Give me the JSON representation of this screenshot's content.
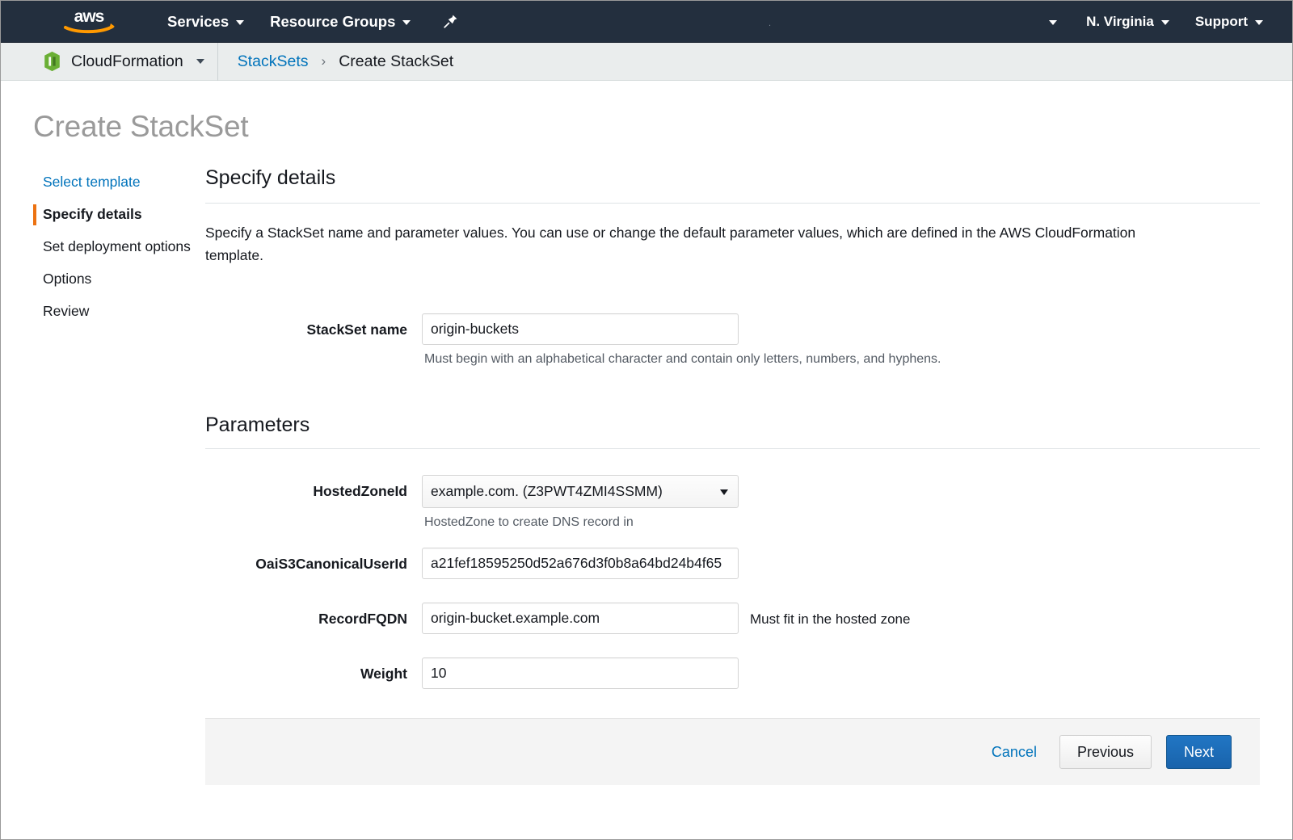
{
  "topnav": {
    "logo_alt": "aws-logo",
    "services_label": "Services",
    "resource_groups_label": "Resource Groups",
    "pin_icon": "pin-icon",
    "account_placeholder": ".",
    "region_label": "N. Virginia",
    "support_label": "Support",
    "bg_color": "#232f3e"
  },
  "breadcrumb": {
    "service_icon": "cloudformation-icon",
    "service_label": "CloudFormation",
    "items": [
      {
        "label": "StackSets",
        "link": true
      },
      {
        "label": "Create StackSet",
        "link": false
      }
    ],
    "separator": "›",
    "link_color": "#0073bb"
  },
  "page": {
    "title": "Create StackSet"
  },
  "sidebar": {
    "items": [
      {
        "label": "Select template",
        "state": "link"
      },
      {
        "label": "Specify details",
        "state": "active"
      },
      {
        "label": "Set deployment options",
        "state": "default"
      },
      {
        "label": "Options",
        "state": "default"
      },
      {
        "label": "Review",
        "state": "default"
      }
    ],
    "active_marker_color": "#ec7211"
  },
  "main": {
    "heading": "Specify details",
    "description": "Specify a StackSet name and parameter values. You can use or change the default parameter values, which are defined in the AWS CloudFormation template.",
    "stackset_name": {
      "label": "StackSet name",
      "value": "origin-buckets",
      "hint": "Must begin with an alphabetical character and contain only letters, numbers, and hyphens."
    },
    "parameters_heading": "Parameters",
    "parameters": [
      {
        "label": "HostedZoneId",
        "type": "select",
        "value": "example.com. (Z3PWT4ZMI4SSMM)",
        "hint": "HostedZone to create DNS record in",
        "side_hint": ""
      },
      {
        "label": "OaiS3CanonicalUserId",
        "type": "text",
        "value": "a21fef18595250d52a676d3f0b8a64bd24b4f65",
        "hint": "",
        "side_hint": ""
      },
      {
        "label": "RecordFQDN",
        "type": "text",
        "value": "origin-bucket.example.com",
        "hint": "",
        "side_hint": "Must fit in the hosted zone"
      },
      {
        "label": "Weight",
        "type": "text",
        "value": "10",
        "hint": "",
        "side_hint": ""
      }
    ]
  },
  "footer": {
    "cancel_label": "Cancel",
    "previous_label": "Previous",
    "next_label": "Next",
    "primary_color": "#1963ab"
  }
}
